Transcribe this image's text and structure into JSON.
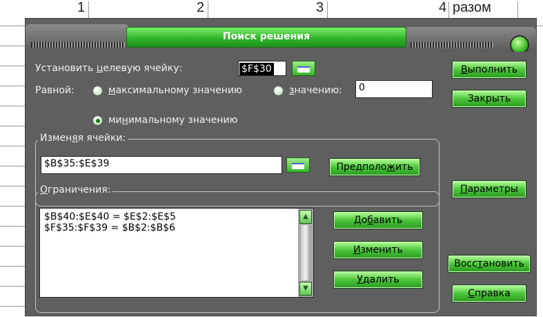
{
  "sheet": {
    "columns": [
      "1",
      "2",
      "3",
      "4"
    ],
    "extra_header_text": "разом"
  },
  "dialog": {
    "title": "Поиск решения",
    "target": {
      "label_pre": "Установить ",
      "label_u": "ц",
      "label_post": "елевую ячейку:",
      "value": "$F$30"
    },
    "equal": {
      "label": "Равной:",
      "options": [
        {
          "pre": "",
          "u": "м",
          "post": "аксимальному значению",
          "selected": false
        },
        {
          "pre": "",
          "u": "з",
          "post": "начению:",
          "selected": false
        },
        {
          "pre": "ми",
          "u": "н",
          "post": "имальному значению",
          "selected": true
        }
      ],
      "value_field": "0"
    },
    "changing": {
      "legend_pre": "Измен",
      "legend_u": "я",
      "legend_post": "я ячейки:",
      "value": "$B$35:$E$39",
      "guess_pre": "Предполо",
      "guess_u": "ж",
      "guess_post": "ить"
    },
    "constraints": {
      "legend_pre": "",
      "legend_u": "О",
      "legend_post": "граничения:",
      "items": [
        "$B$40:$E$40 = $E$2:$E$5",
        "$F$35:$F$39 = $B$2:$B$6"
      ],
      "add": {
        "pre": "До",
        "u": "б",
        "post": "авить"
      },
      "change": {
        "pre": "",
        "u": "И",
        "post": "зменить"
      },
      "delete": {
        "pre": "",
        "u": "У",
        "post": "далить"
      }
    },
    "buttons": {
      "solve": {
        "pre": "",
        "u": "В",
        "post": "ыполнить"
      },
      "close": {
        "label": "Закрыть"
      },
      "options": {
        "pre": "",
        "u": "П",
        "post": "араметры"
      },
      "reset": {
        "pre": "Восс",
        "u": "т",
        "post": "ановить"
      },
      "help": {
        "pre": "",
        "u": "С",
        "post": "правка"
      }
    }
  }
}
